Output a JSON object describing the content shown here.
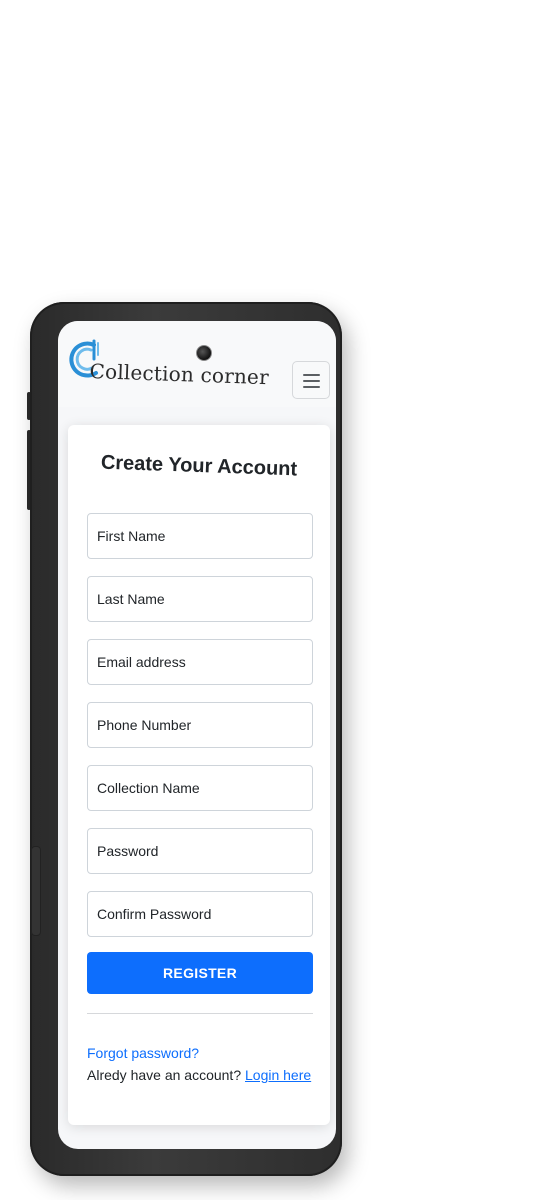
{
  "navbar": {
    "brand_name": "Collection corner",
    "menu_icon": "hamburger-menu-icon",
    "brand_icon": "collection-corner-logo-icon"
  },
  "register_form": {
    "title": "Create Your Account",
    "fields": [
      {
        "placeholder": "First Name"
      },
      {
        "placeholder": "Last Name"
      },
      {
        "placeholder": "Email address"
      },
      {
        "placeholder": "Phone Number"
      },
      {
        "placeholder": "Collection Name"
      },
      {
        "placeholder": "Password"
      },
      {
        "placeholder": "Confirm Password"
      }
    ],
    "submit_label": "REGISTER",
    "forgot_password_label": "Forgot password?",
    "have_account_text": "Alredy have an account?",
    "login_link_label": "Login here"
  },
  "colors": {
    "primary": "#0d6efd",
    "logo_blue": "#2a8fd6",
    "phone_frame": "#2e2e2e"
  }
}
